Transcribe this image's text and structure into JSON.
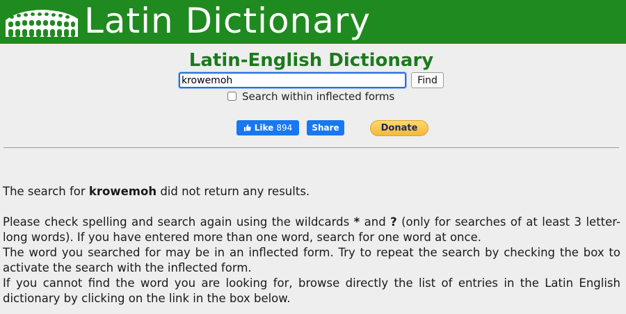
{
  "header": {
    "site_title": "Latin Dictionary",
    "logo_icon": "colosseum-icon",
    "background_color": "#1f8a1f"
  },
  "main": {
    "dict_title": "Latin-English Dictionary",
    "search": {
      "value": "krowemoh",
      "find_label": "Find"
    },
    "inflected_checkbox": {
      "label": "Search within inflected forms",
      "checked": false
    },
    "social": {
      "like_label": "Like",
      "like_count": "894",
      "share_label": "Share",
      "donate_label": "Donate",
      "facebook_color": "#1877f2"
    }
  },
  "result": {
    "prefix": "The search for ",
    "term": "krowemoh",
    "suffix": " did not return any results."
  },
  "help": {
    "p1_a": "Please check spelling and search again using the wildcards ",
    "wildcard_star": "*",
    "p1_and": " and ",
    "wildcard_q": "?",
    "p1_b": " (only for searches of at least 3 letter-long words). If you have entered more than one word, search for one word at once.",
    "p2": "The word you searched for may be in an inflected form. Try to repeat the search by checking the box to activate the search with the inflected form.",
    "p3": "If you cannot find the word you are looking for, browse directly the list of entries in the Latin English dictionary by clicking on the link in the box below."
  }
}
